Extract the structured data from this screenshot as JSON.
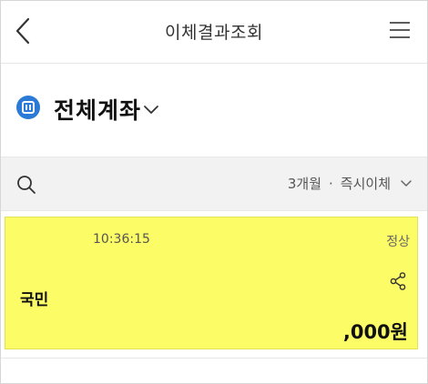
{
  "header": {
    "title": "이체결과조회",
    "back_icon": "chevron-left-icon",
    "menu_icon": "hamburger-menu-icon"
  },
  "account": {
    "label": "전체계좌",
    "dropdown_icon": "chevron-down-icon",
    "logo_icon": "bank-logo-icon"
  },
  "filter": {
    "period": "3개월",
    "separator": "·",
    "type": "즉시이체",
    "search_icon": "search-icon",
    "dropdown_icon": "chevron-down-icon"
  },
  "transactions": [
    {
      "time": "10:36:15",
      "status": "정상",
      "bank": "국민",
      "amount": ",000원",
      "share_icon": "share-icon"
    }
  ],
  "colors": {
    "highlight": "#fcfc66",
    "filter_bg": "#f2f2f2",
    "logo_blue": "#2a7ad6"
  }
}
